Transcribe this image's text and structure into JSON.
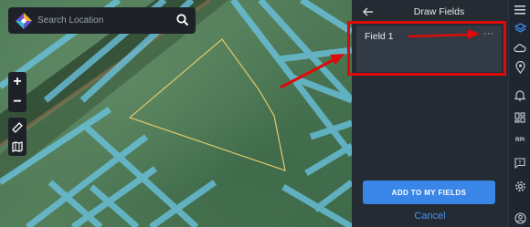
{
  "search": {
    "placeholder": "Search Location"
  },
  "map_controls": {
    "zoom_in_label": "+",
    "zoom_out_label": "−"
  },
  "panel": {
    "title": "Draw Fields",
    "fields": [
      {
        "name": "Field 1",
        "more_label": "···"
      }
    ],
    "add_button_label": "ADD TO MY FIELDS",
    "cancel_label": "Cancel"
  },
  "rail": {
    "rpi_label": "RPI",
    "icons": [
      "menu-icon",
      "layers-icon",
      "cloud-icon",
      "location-pin-icon",
      "bell-icon",
      "dashboard-icon",
      "rpi-icon",
      "chat-icon",
      "settings-icon",
      "account-icon"
    ]
  },
  "colors": {
    "accent_blue": "#3a86e8",
    "annotation_red": "#e00a0a",
    "field_outline": "#e2c86a",
    "panel_bg": "#252b33"
  }
}
